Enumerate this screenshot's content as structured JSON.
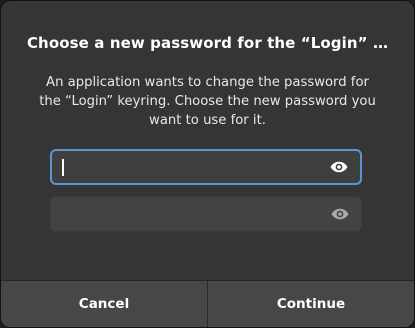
{
  "dialog": {
    "title": "Choose a new password for the “Login” …",
    "message_lines": [
      "An application wants to change the password for",
      "the “Login” keyring. Choose the new password you",
      "want to use for it."
    ],
    "password_field": {
      "value": "",
      "placeholder": "",
      "reveal_icon": "eye-icon"
    },
    "confirm_field": {
      "value": "",
      "placeholder": "",
      "reveal_icon": "eye-icon"
    },
    "buttons": {
      "cancel_label": "Cancel",
      "continue_label": "Continue"
    }
  },
  "colors": {
    "background": "#353535",
    "focus_ring": "#5e93d4",
    "button": "#474747",
    "text": "#ffffff"
  }
}
